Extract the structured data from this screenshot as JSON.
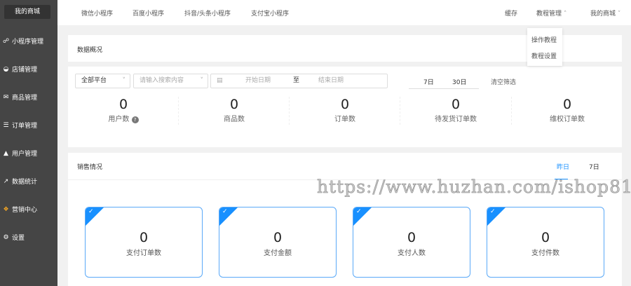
{
  "sidebar": {
    "logo": "我的商城",
    "items": [
      {
        "label": "小程序管理",
        "icon": "link-icon"
      },
      {
        "label": "店铺管理",
        "icon": "store-icon"
      },
      {
        "label": "商品管理",
        "icon": "goods-icon"
      },
      {
        "label": "订单管理",
        "icon": "order-icon"
      },
      {
        "label": "用户管理",
        "icon": "user-icon"
      },
      {
        "label": "数据统计",
        "icon": "chart-icon"
      },
      {
        "label": "营销中心",
        "icon": "marketing-icon"
      },
      {
        "label": "设置",
        "icon": "gear-icon"
      }
    ]
  },
  "topbar": {
    "tabs": [
      "微信小程序",
      "百度小程序",
      "抖音/头条小程序",
      "支付宝小程序"
    ],
    "cache": "缓存",
    "tutorial": "教程管理",
    "shop": "我的商城"
  },
  "dropdown": [
    "操作教程",
    "教程设置"
  ],
  "overview": {
    "title": "数据概况",
    "platform": "全部平台",
    "search_placeholder": "请输入搜索内容",
    "start_date": "开始日期",
    "to": "至",
    "end_date": "结束日期",
    "range_7": "7日",
    "range_30": "30日",
    "clear": "清空筛选",
    "stats": [
      {
        "value": "0",
        "label": "用户数"
      },
      {
        "value": "0",
        "label": "商品数"
      },
      {
        "value": "0",
        "label": "订单数"
      },
      {
        "value": "0",
        "label": "待发货订单数"
      },
      {
        "value": "0",
        "label": "维权订单数"
      }
    ]
  },
  "sales": {
    "title": "销售情况",
    "tab_yesterday": "昨日",
    "tab_7": "7日",
    "cards": [
      {
        "value": "0",
        "label": "支付订单数"
      },
      {
        "value": "0",
        "label": "支付金额"
      },
      {
        "value": "0",
        "label": "支付人数"
      },
      {
        "value": "0",
        "label": "支付件数"
      }
    ]
  },
  "watermark": "https://www.huzhan.com/ishop81",
  "colors": {
    "accent": "#1890ff",
    "sidebar": "#454545"
  }
}
